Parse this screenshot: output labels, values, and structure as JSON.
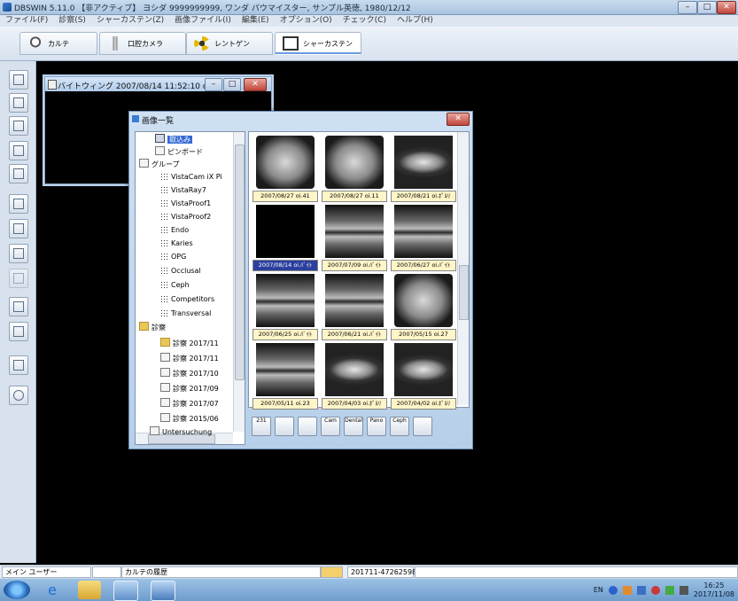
{
  "window": {
    "title": "DBSWIN 5.11.0  【非アクティブ】       ヨシダ     9999999999, ワンダ パウマイスター, サンプル英徳, 1980/12/12"
  },
  "menu": [
    "ファイル(F)",
    "診察(S)",
    "シャーカステン(Z)",
    "画像ファイル(I)",
    "編集(E)",
    "オプション(O)",
    "チェック(C)",
    "ヘルプ(H)"
  ],
  "tabs": [
    {
      "label": "カルテ",
      "icon": "tooth-icon"
    },
    {
      "label": "口腔カメラ",
      "icon": "camera-icon"
    },
    {
      "label": "レントゲン",
      "icon": "xray-icon"
    },
    {
      "label": "シャーカステン",
      "icon": "lightbox-icon",
      "active": true
    }
  ],
  "bitewing_window": {
    "title": "バイトウィング 2007/08/14 11:52:10 orig..."
  },
  "image_list": {
    "title": "画像一覧",
    "tree": [
      {
        "label": "取込み",
        "level": 1,
        "selected": true
      },
      {
        "label": "ピンボード",
        "level": 1
      },
      {
        "label": "グループ",
        "level": 0
      },
      {
        "label": "VistaCam iX Pi",
        "level": 2
      },
      {
        "label": "VistaRay7",
        "level": 2
      },
      {
        "label": "VistaProof1",
        "level": 2
      },
      {
        "label": "VistaProof2",
        "level": 2
      },
      {
        "label": "Endo",
        "level": 2
      },
      {
        "label": "Karies",
        "level": 2
      },
      {
        "label": "OPG",
        "level": 2
      },
      {
        "label": "Occlusal",
        "level": 2
      },
      {
        "label": "Ceph",
        "level": 2
      },
      {
        "label": "Competitors",
        "level": 2
      },
      {
        "label": "Transversal",
        "level": 2
      },
      {
        "label": "診察",
        "level": 0
      },
      {
        "label": "診察  2017/11",
        "level": 2
      },
      {
        "label": "診察  2017/11",
        "level": 2
      },
      {
        "label": "診察  2017/10",
        "level": 2
      },
      {
        "label": "診察  2017/09",
        "level": 2
      },
      {
        "label": "診察  2017/07",
        "level": 2
      },
      {
        "label": "診察  2015/06",
        "level": 2
      },
      {
        "label": "Untersuchung",
        "level": 1
      }
    ],
    "thumbnails": [
      {
        "caption": "2007/08/27 oi.41",
        "kind": "peri"
      },
      {
        "caption": "2007/08/27 oi.11",
        "kind": "peri"
      },
      {
        "caption": "2007/08/21 oi.ﾎﾟﾙﾘ",
        "kind": "pano"
      },
      {
        "caption": "2007/08/14 oi.ﾊﾞｲﾄ",
        "kind": "black",
        "selected": true
      },
      {
        "caption": "2007/07/09 oi.ﾊﾞｲﾄ",
        "kind": "bite"
      },
      {
        "caption": "2007/06/27 oi.ﾊﾞｲﾄ",
        "kind": "bite"
      },
      {
        "caption": "2007/06/25 oi.ﾊﾞｲﾄ",
        "kind": "bite"
      },
      {
        "caption": "2007/06/21 oi.ﾊﾞｲﾄ",
        "kind": "bite"
      },
      {
        "caption": "2007/05/15 oi.27",
        "kind": "peri"
      },
      {
        "caption": "2007/05/11 oi.23",
        "kind": "bite"
      },
      {
        "caption": "2007/04/03 oi.ﾎﾟﾙﾘ",
        "kind": "pano"
      },
      {
        "caption": "2007/04/02 oi.ﾎﾟﾙﾘ",
        "kind": "pano"
      }
    ],
    "bottom_tools": [
      {
        "name": "number-sort-tool",
        "label": "231"
      },
      {
        "name": "tooth-filter-tool",
        "label": ""
      },
      {
        "name": "magnify-tool",
        "label": ""
      },
      {
        "name": "cam-filter-tool",
        "label": "Cam"
      },
      {
        "name": "dental-filter-tool",
        "label": "Dental"
      },
      {
        "name": "pano-filter-tool",
        "label": "Pano"
      },
      {
        "name": "ceph-filter-tool",
        "label": "Ceph"
      },
      {
        "name": "extra-filter-tool",
        "label": ""
      }
    ]
  },
  "statusbar": {
    "user": "メイン ユーザー",
    "box2": "",
    "history": "カルテの履歴",
    "record_id": "201711-47262598"
  },
  "taskbar": {
    "lang": "EN",
    "time": "16:25",
    "date": "2017/11/08"
  }
}
